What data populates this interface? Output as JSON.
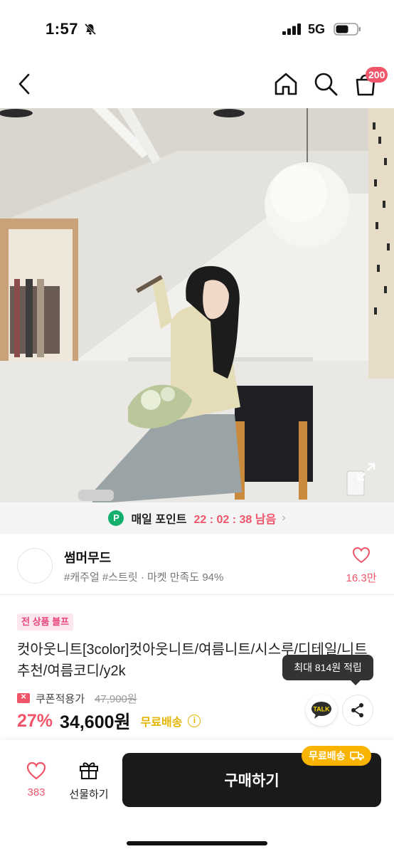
{
  "status_bar": {
    "time": "1:57",
    "network": "5G"
  },
  "header": {
    "cart_count": "200"
  },
  "point_bar": {
    "icon_text": "P",
    "label": "매일 포인트",
    "timer": "22 : 02 : 38 남음",
    "arrow": "›"
  },
  "seller": {
    "name": "썸머무드",
    "tags": "#캐주얼 #스트릿 · 마켓 만족도 94%",
    "like_count": "16.3만"
  },
  "product": {
    "promo_badge": "전 상품 블프",
    "title": "컷아웃니트[3color]컷아웃니트/여름니트/시스루/디테일/니트추천/여름코디/y2k",
    "tooltip": "최대 814원 적립",
    "coupon_label": "쿠폰적용가",
    "original_price": "47,900원",
    "discount_rate": "27%",
    "sale_price": "34,600원",
    "shipping": "무료배송",
    "info_icon": "i",
    "talk_label": "TALK"
  },
  "bottom_bar": {
    "wish_count": "383",
    "gift_label": "선물하기",
    "buy_label": "구매하기",
    "shipping_badge": "무료배송"
  },
  "colors": {
    "accent": "#f0556a",
    "shipping": "#e6b400",
    "point": "#14b06b",
    "buy": "#1a1a1a"
  }
}
